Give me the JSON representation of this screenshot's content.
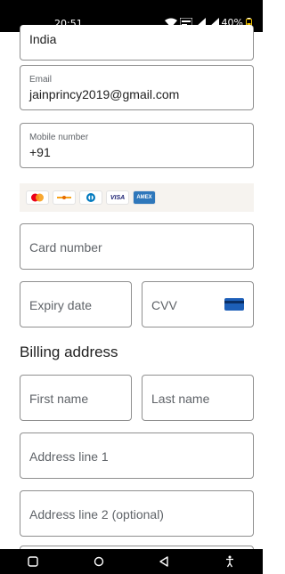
{
  "status_bar": {
    "time": "20:51",
    "battery": "40%"
  },
  "form": {
    "country_value": "India",
    "email_label": "Email",
    "email_value": "jainprincy2019@gmail.com",
    "mobile_label": "Mobile number",
    "mobile_value": "+91",
    "card_brands": [
      "mastercard",
      "discover",
      "diners",
      "VISA",
      "AMEX"
    ],
    "card_number_placeholder": "Card number",
    "expiry_placeholder": "Expiry date",
    "cvv_placeholder": "CVV",
    "billing_title": "Billing address",
    "first_name_placeholder": "First name",
    "last_name_placeholder": "Last name",
    "address1_placeholder": "Address line 1",
    "address2_placeholder": "Address line 2 (optional)"
  },
  "nav": {
    "recents": "recents-icon",
    "home": "home-icon",
    "back": "back-icon",
    "accessibility": "accessibility-icon"
  }
}
